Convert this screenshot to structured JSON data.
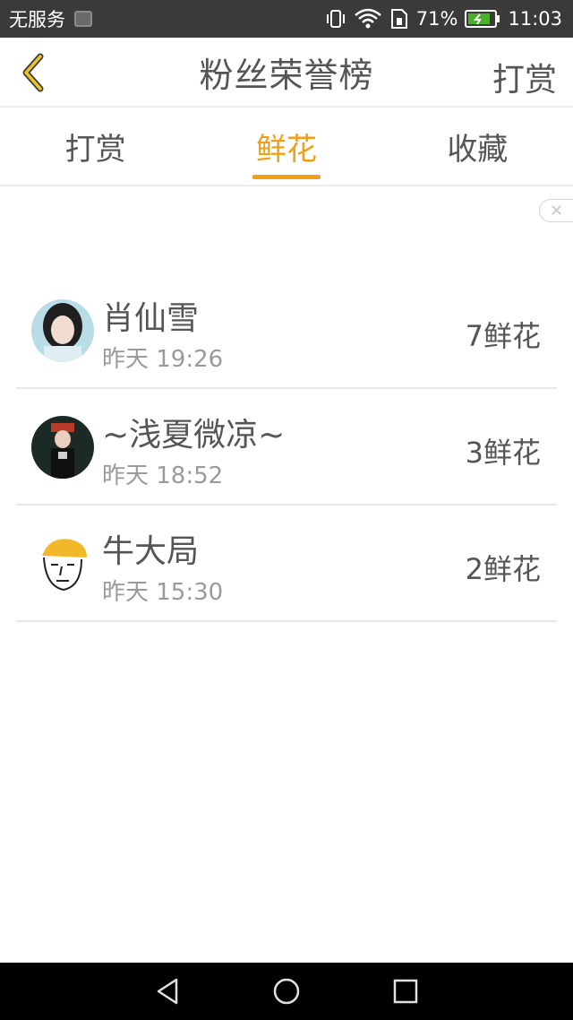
{
  "status_bar": {
    "carrier": "无服务",
    "battery_percent": "71%",
    "time": "11:03"
  },
  "header": {
    "title": "粉丝荣誉榜",
    "action_label": "打赏"
  },
  "tabs": [
    {
      "label": "打赏",
      "active": false
    },
    {
      "label": "鲜花",
      "active": true
    },
    {
      "label": "收藏",
      "active": false
    }
  ],
  "entries": [
    {
      "name": "肖仙雪",
      "time": "昨天 19:26",
      "count": "7鲜花"
    },
    {
      "name": "~浅夏微凉~",
      "time": "昨天 18:52",
      "count": "3鲜花"
    },
    {
      "name": "牛大局",
      "time": "昨天 15:30",
      "count": "2鲜花"
    }
  ],
  "colors": {
    "accent": "#f09f16",
    "text_primary": "#555555",
    "text_secondary": "#9a9a9a",
    "status_bar_bg": "#3a3a3a",
    "nav_bar_bg": "#000000"
  },
  "icons": {
    "back": "chevron-left-icon",
    "close_ad": "close-icon",
    "nav_back": "triangle-back-icon",
    "nav_home": "circle-home-icon",
    "nav_recents": "square-recents-icon"
  }
}
